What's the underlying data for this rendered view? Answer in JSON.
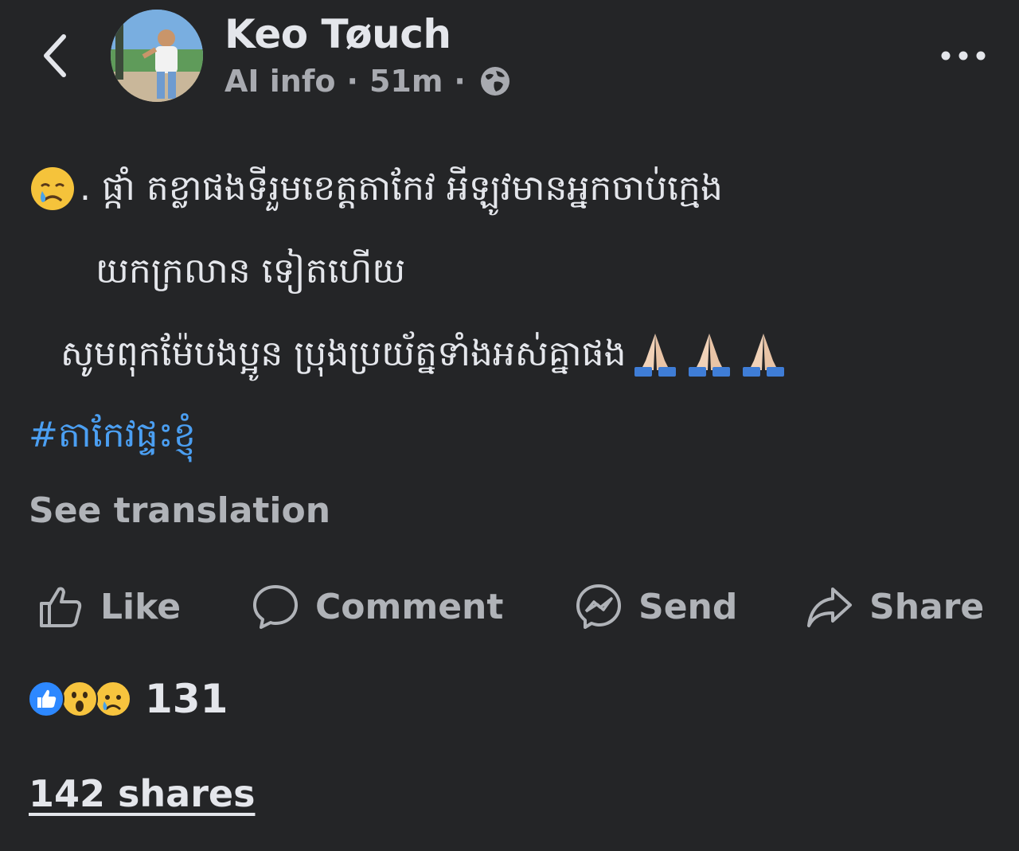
{
  "header": {
    "author_name": "Keo Tøuch",
    "meta_label": "AI info",
    "time_ago": "51m",
    "separator": "·",
    "audience_icon": "globe-icon"
  },
  "post": {
    "line1_prefix": ". ",
    "line1": "ផ្កាំ តខ្លាផងទីរួមខេត្តតាកែវ អីឡូវមានអ្នកចាប់ក្មេង",
    "line2": "យកក្រលាន ទៀតហើយ",
    "line3": "សូមពុកម៉ែបងប្អូន ប្រុងប្រយ័ត្នទាំងអស់គ្នាផង",
    "hashtag": "#តាកែវផ្ទះខ្ញុំ",
    "emoji_leading": "crying-face",
    "emoji_trailing": [
      "folded-hands",
      "folded-hands",
      "folded-hands"
    ]
  },
  "see_translation": "See translation",
  "actions": {
    "like": "Like",
    "comment": "Comment",
    "send": "Send",
    "share": "Share"
  },
  "reactions": {
    "types": [
      "like",
      "wow",
      "sad"
    ],
    "count": "131"
  },
  "shares": "142 shares",
  "colors": {
    "background": "#242527",
    "text_primary": "#e4e6eb",
    "text_secondary": "#b0b3b8",
    "hashtag": "#4b9ff2",
    "like_blue": "#2d88ff"
  }
}
